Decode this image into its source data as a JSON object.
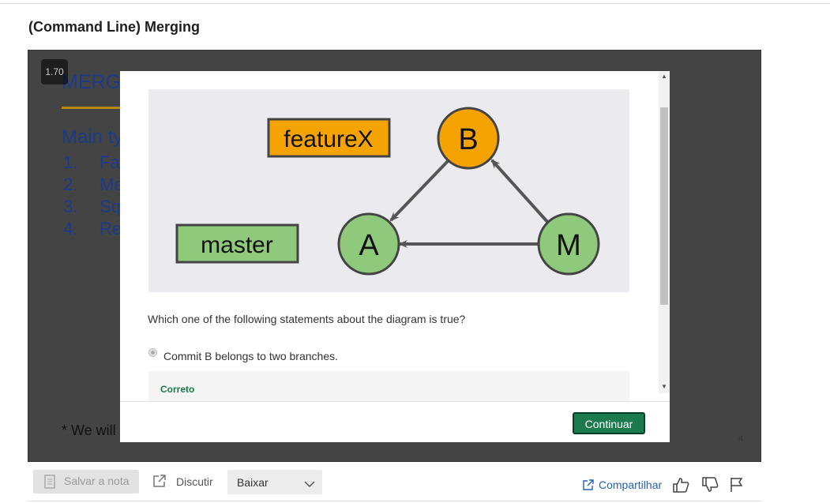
{
  "page": {
    "title": "(Command Line) Merging"
  },
  "player": {
    "speed": "1.70",
    "slide": {
      "title": "MERG",
      "subtitle": "Main ty",
      "items": [
        {
          "num": "1.",
          "text": "Fa"
        },
        {
          "num": "2.",
          "text": "Me"
        },
        {
          "num": "3.",
          "text": "Sq"
        },
        {
          "num": "4.",
          "text": "Re"
        }
      ],
      "footnote": "* We will",
      "page_number": "4"
    }
  },
  "modal": {
    "diagram": {
      "labels": {
        "branch_feature": "featureX",
        "branch_master": "master"
      },
      "commits": {
        "b": "B",
        "a": "A",
        "m": "M"
      },
      "colors": {
        "feature_fill": "#f5a300",
        "master_fill": "#8fc97c",
        "background": "#ebebef",
        "arrow": "#555555"
      }
    },
    "question": "Which one of the following statements about the diagram is true?",
    "answer": "Commit B belongs to two branches.",
    "feedback": "Correto",
    "continue_label": "Continuar"
  },
  "toolbar": {
    "save_label": "Salvar a nota",
    "discuss_label": "Discutir",
    "download_label": "Baixar",
    "share_label": "Compartilhar"
  },
  "colors": {
    "primary_green": "#1c7a4f",
    "link_blue": "#2163b6"
  }
}
